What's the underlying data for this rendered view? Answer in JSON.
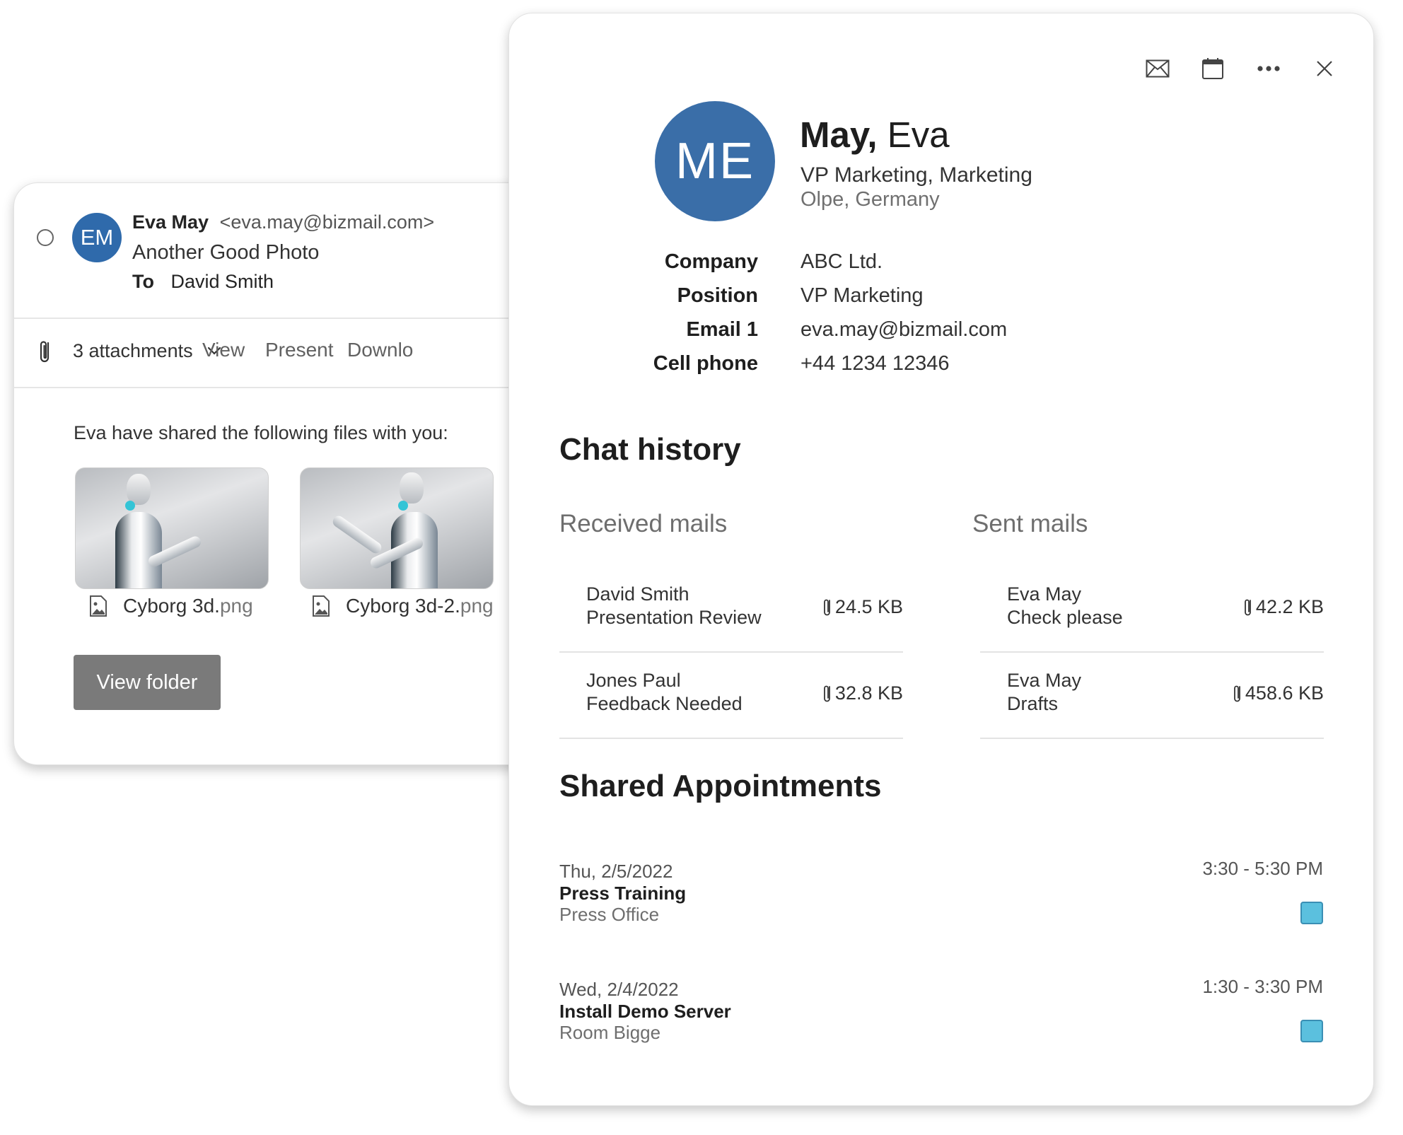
{
  "mail": {
    "avatar_initials": "EM",
    "sender_name": "Eva May",
    "sender_email": "<eva.may@bizmail.com>",
    "subject": "Another Good Photo",
    "to_label": "To",
    "to_name": "David Smith",
    "attachments_label": "3 attachments",
    "actions": {
      "view": "View",
      "present": "Present",
      "download": "Downlo"
    },
    "shared_text": "Eva have shared the following files with you:",
    "files": [
      {
        "base": "Cyborg 3d.",
        "ext": "png"
      },
      {
        "base": "Cyborg 3d-2.",
        "ext": "png"
      }
    ],
    "view_folder_label": "View folder"
  },
  "contact": {
    "avatar_initials": "ME",
    "last_name": "May,",
    "first_name": "Eva",
    "job_title": "VP Marketing, Marketing",
    "location": "Olpe, Germany",
    "details": [
      {
        "label": "Company",
        "value": "ABC Ltd."
      },
      {
        "label": "Position",
        "value": "VP Marketing"
      },
      {
        "label": "Email 1",
        "value": "eva.may@bizmail.com"
      },
      {
        "label": "Cell phone",
        "value": "+44 1234 12346"
      }
    ],
    "chat_history_title": "Chat history",
    "received_title": "Received mails",
    "sent_title": "Sent mails",
    "received": [
      {
        "sender": "David Smith",
        "subject": "Presentation Review",
        "size": "24.5 KB"
      },
      {
        "sender": "Jones Paul",
        "subject": "Feedback Needed",
        "size": "32.8 KB"
      }
    ],
    "sent": [
      {
        "sender": "Eva May",
        "subject": "Check please",
        "size": "42.2 KB"
      },
      {
        "sender": "Eva May",
        "subject": "Drafts",
        "size": "458.6 KB"
      }
    ],
    "appointments_title": "Shared Appointments",
    "appointments": [
      {
        "date": "Thu, 2/5/2022",
        "title": "Press Training",
        "place": "Press Office",
        "time": "3:30 - 5:30 PM",
        "color": "#5bc0de"
      },
      {
        "date": "Wed, 2/4/2022",
        "title": "Install Demo Server",
        "place": "Room Bigge",
        "time": "1:30 - 3:30 PM",
        "color": "#5bc0de"
      }
    ]
  },
  "colors": {
    "avatar_blue": "#2f6aab",
    "accent_cyan": "#5bc0de",
    "button_gray": "#7a7a7a"
  }
}
